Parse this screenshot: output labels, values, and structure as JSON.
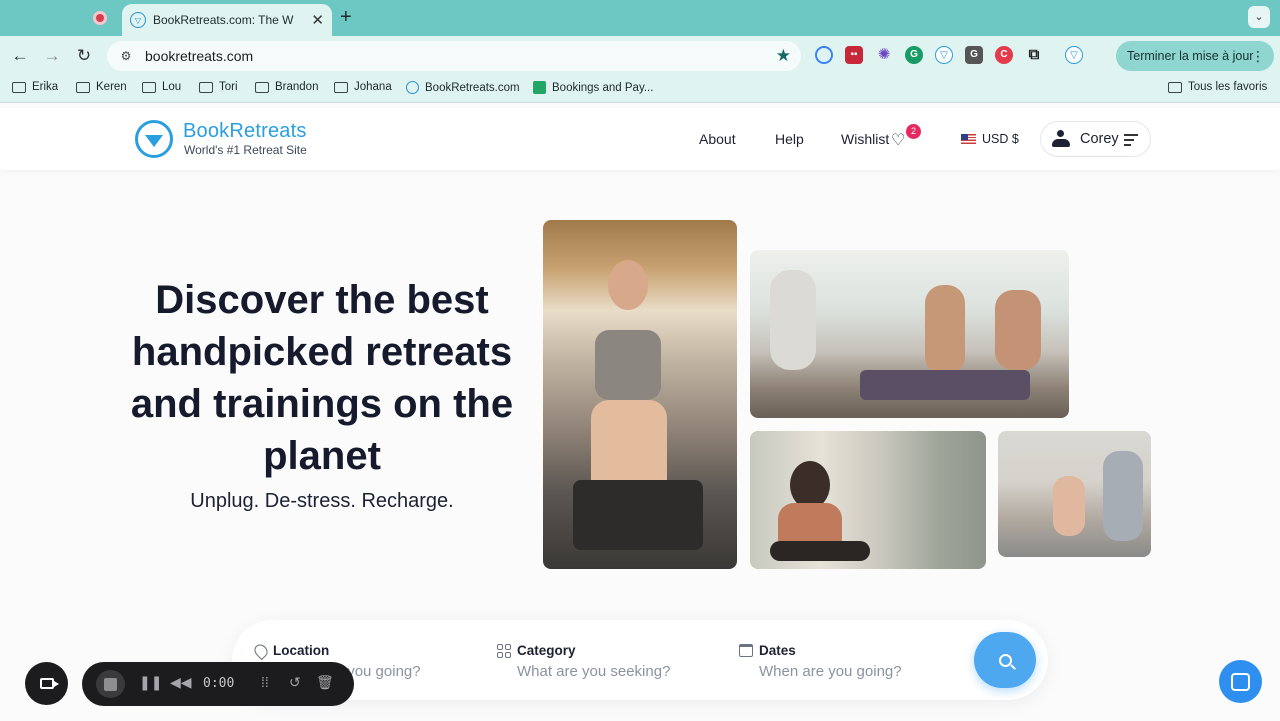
{
  "browser": {
    "active_tab_title": "BookRetreats.com: The W",
    "url": "bookretreats.com",
    "update_button": "Terminer la mise à jour",
    "bookmarks": [
      "Erika",
      "Keren",
      "Lou",
      "Tori",
      "Brandon",
      "Johana",
      "BookRetreats.com",
      "Bookings and Pay..."
    ],
    "all_bookmarks": "Tous les favoris"
  },
  "header": {
    "brand": "BookRetreats",
    "tagline": "World's #1 Retreat Site",
    "nav": {
      "about": "About",
      "help": "Help",
      "wishlist": "Wishlist"
    },
    "wishlist_count": "2",
    "currency": "USD $",
    "user_name": "Corey"
  },
  "hero": {
    "title": "Discover the best handpicked retreats and trainings on the planet",
    "subtitle": "Unplug. De-stress. Recharge."
  },
  "search": {
    "location_label": "Location",
    "location_placeholder": "Where are you going?",
    "category_label": "Category",
    "category_placeholder": "What are you seeking?",
    "dates_label": "Dates",
    "dates_placeholder": "When are you going?"
  },
  "recorder": {
    "time": "0:00"
  },
  "colors": {
    "brand": "#2a9fe0",
    "search_button": "#4ea8ef",
    "wishlist_badge": "#e6285e",
    "chrome": "#6dc7c2"
  }
}
